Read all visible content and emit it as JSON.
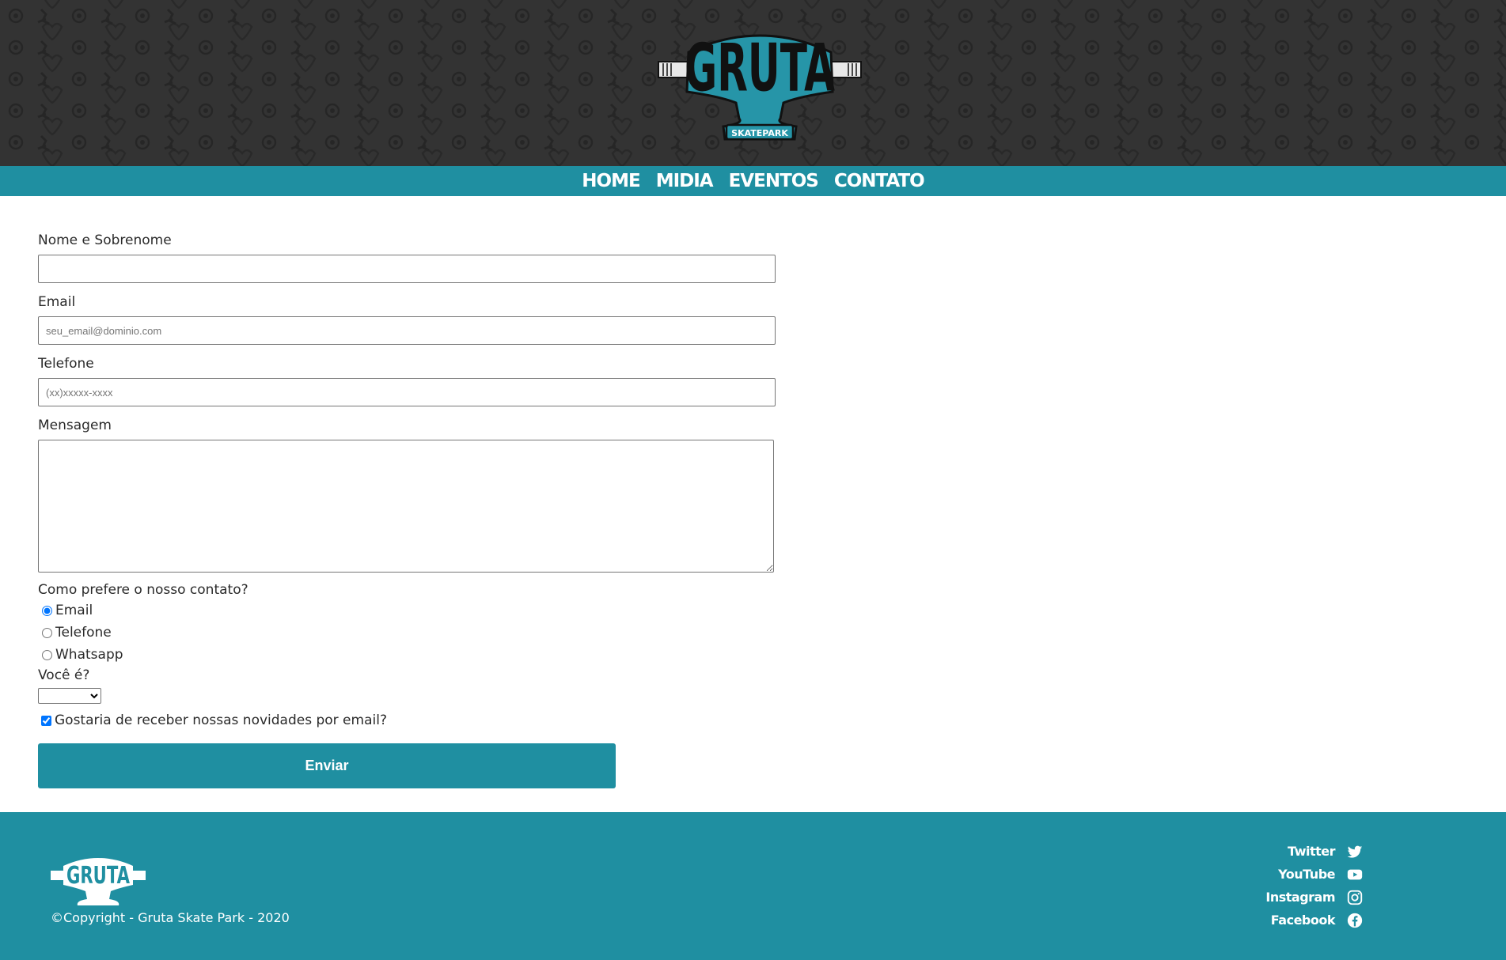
{
  "header": {
    "logo_text": "GRUTA",
    "logo_subtext": "SKATEPARK"
  },
  "nav": {
    "items": [
      {
        "label": "HOME"
      },
      {
        "label": "MIDIA"
      },
      {
        "label": "EVENTOS"
      },
      {
        "label": "CONTATO"
      }
    ]
  },
  "form": {
    "name_label": "Nome e Sobrenome",
    "name_value": "",
    "email_label": "Email",
    "email_placeholder": "seu_email@dominio.com",
    "phone_label": "Telefone",
    "phone_placeholder": "(xx)xxxxx-xxxx",
    "message_label": "Mensagem",
    "contact_pref_label": "Como prefere o nosso contato?",
    "contact_options": [
      {
        "label": "Email",
        "checked": true
      },
      {
        "label": "Telefone",
        "checked": false
      },
      {
        "label": "Whatsapp",
        "checked": false
      }
    ],
    "role_label": "Você é?",
    "role_selected": "",
    "newsletter_label": "Gostaria de receber nossas novidades por email?",
    "newsletter_checked": true,
    "submit_label": "Enviar"
  },
  "footer": {
    "logo_text": "GRUTA",
    "copyright": "©Copyright - Gruta Skate Park - 2020",
    "social": [
      {
        "label": "Twitter",
        "icon": "twitter-icon"
      },
      {
        "label": "YouTube",
        "icon": "youtube-icon"
      },
      {
        "label": "Instagram",
        "icon": "instagram-icon"
      },
      {
        "label": "Facebook",
        "icon": "facebook-icon"
      }
    ]
  },
  "colors": {
    "brand": "#1f8fa1",
    "header_bg": "#333333",
    "logo_teal": "#2695a8"
  }
}
